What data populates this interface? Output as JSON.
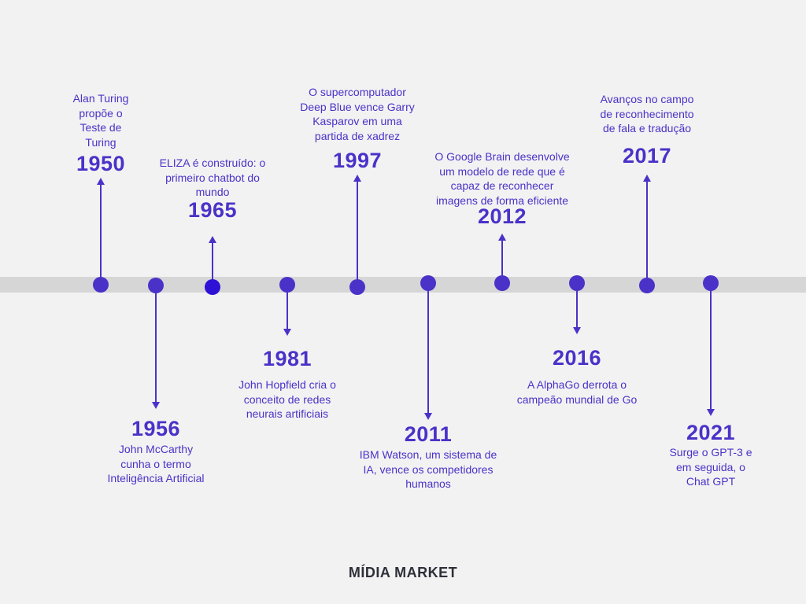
{
  "events": [
    {
      "year": "1950",
      "text": "Alan Turing propõe o Teste de Turing"
    },
    {
      "year": "1956",
      "text": "John McCarthy cunha o termo Inteligência Artificial"
    },
    {
      "year": "1965",
      "text": "ELIZA é construído: o primeiro chatbot do mundo"
    },
    {
      "year": "1981",
      "text": "John Hopfield cria o conceito de redes neurais artificiais"
    },
    {
      "year": "1997",
      "text": "O supercomputador Deep Blue vence Garry Kasparov em uma partida de xadrez"
    },
    {
      "year": "2011",
      "text": "IBM Watson, um sistema de IA, vence os competidores humanos"
    },
    {
      "year": "2012",
      "text": "O Google Brain desenvolve um modelo de rede que é capaz de reconhecer imagens de forma eficiente"
    },
    {
      "year": "2016",
      "text": "A AlphaGo derrota o campeão mundial de Go"
    },
    {
      "year": "2017",
      "text": "Avanços no campo de reconhecimento de fala e tradução"
    },
    {
      "year": "2021",
      "text": "Surge o GPT-3 e em seguida, o Chat GPT"
    }
  ],
  "brand": "MÍDIA MARKET",
  "colors": {
    "accent": "#4a32c8",
    "axis": "#d6d6d6",
    "background": "#f2f2f2"
  }
}
